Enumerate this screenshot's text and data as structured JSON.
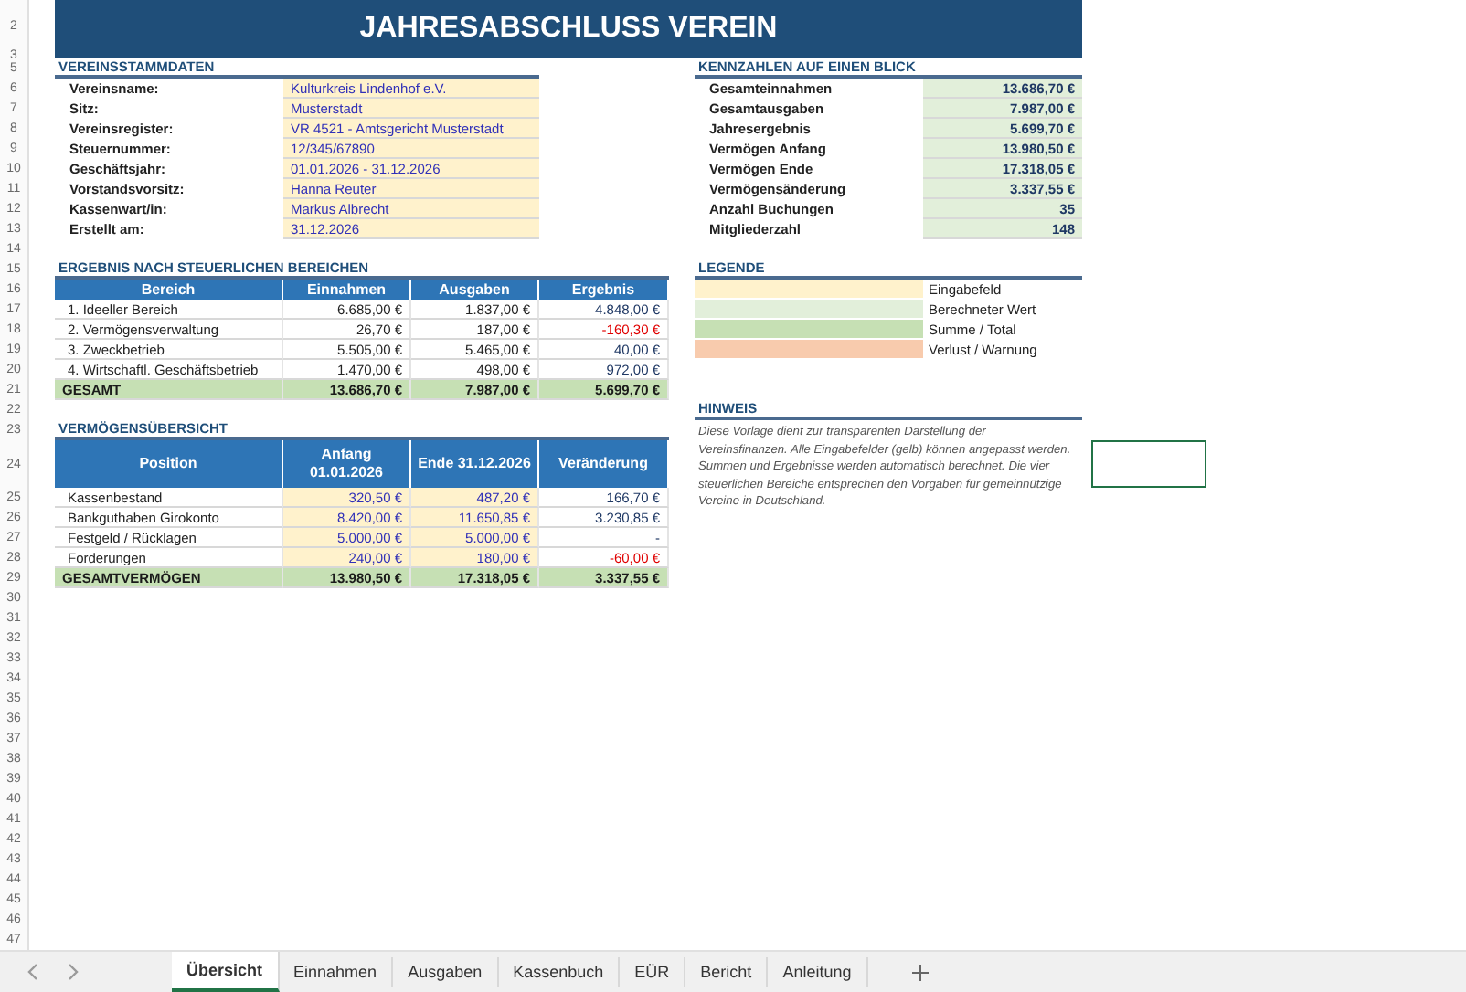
{
  "title": "JAHRESABSCHLUSS VEREIN",
  "row_numbers": [
    "2",
    "3",
    "5",
    "6",
    "7",
    "8",
    "9",
    "10",
    "11",
    "12",
    "13",
    "14",
    "15",
    "16",
    "17",
    "18",
    "19",
    "20",
    "21",
    "22",
    "23",
    "24",
    "25",
    "26",
    "27",
    "28",
    "29",
    "30",
    "31",
    "32",
    "33",
    "34",
    "35",
    "36",
    "37",
    "38",
    "39",
    "40",
    "41",
    "42",
    "43",
    "44",
    "45",
    "46",
    "47"
  ],
  "master_data": {
    "heading": "VEREINSSTAMMDATEN",
    "items": [
      {
        "label": "Vereinsname:",
        "value": "Kulturkreis Lindenhof e.V."
      },
      {
        "label": "Sitz:",
        "value": "Musterstadt"
      },
      {
        "label": "Vereinsregister:",
        "value": "VR 4521 - Amtsgericht Musterstadt"
      },
      {
        "label": "Steuernummer:",
        "value": "12/345/67890"
      },
      {
        "label": "Geschäftsjahr:",
        "value": "01.01.2026 - 31.12.2026"
      },
      {
        "label": "Vorstandsvorsitz:",
        "value": "Hanna Reuter"
      },
      {
        "label": "Kassenwart/in:",
        "value": "Markus Albrecht"
      },
      {
        "label": "Erstellt am:",
        "value": "31.12.2026"
      }
    ]
  },
  "key_figures": {
    "heading": "KENNZAHLEN AUF EINEN BLICK",
    "items": [
      {
        "label": "Gesamteinnahmen",
        "value": "13.686,70 €"
      },
      {
        "label": "Gesamtausgaben",
        "value": "7.987,00 €"
      },
      {
        "label": "Jahresergebnis",
        "value": "5.699,70 €"
      },
      {
        "label": "Vermögen Anfang",
        "value": "13.980,50 €"
      },
      {
        "label": "Vermögen Ende",
        "value": "17.318,05 €"
      },
      {
        "label": "Vermögensänderung",
        "value": "3.337,55 €"
      },
      {
        "label": "Anzahl Buchungen",
        "value": "35"
      },
      {
        "label": "Mitgliederzahl",
        "value": "148"
      }
    ]
  },
  "results": {
    "heading": "ERGEBNIS NACH STEUERLICHEN BEREICHEN",
    "columns": [
      {
        "label": "Bereich",
        "kind": "text"
      },
      {
        "label": "Einnahmen",
        "kind": "calc"
      },
      {
        "label": "Ausgaben",
        "kind": "calc"
      },
      {
        "label": "Ergebnis",
        "kind": "result"
      }
    ],
    "rows": [
      {
        "cells": [
          "1. Ideeller Bereich",
          "6.685,00 €",
          "1.837,00 €",
          "4.848,00 €"
        ],
        "loss": false
      },
      {
        "cells": [
          "2. Vermögensverwaltung",
          "26,70 €",
          "187,00 €",
          "-160,30 €"
        ],
        "loss": true
      },
      {
        "cells": [
          "3. Zweckbetrieb",
          "5.505,00 €",
          "5.465,00 €",
          "40,00 €"
        ],
        "loss": false
      },
      {
        "cells": [
          "4. Wirtschaftl. Geschäftsbetrieb",
          "1.470,00 €",
          "498,00 €",
          "972,00 €"
        ],
        "loss": false
      }
    ],
    "total": [
      "GESAMT",
      "13.686,70 €",
      "7.987,00 €",
      "5.699,70 €"
    ]
  },
  "legend": {
    "heading": "LEGENDE",
    "items": [
      {
        "label": "Eingabefeld",
        "color": "#fff2cc"
      },
      {
        "label": "Berechneter Wert",
        "color": "#e2efda"
      },
      {
        "label": "Summe / Total",
        "color": "#c6e0b4"
      },
      {
        "label": "Verlust / Warnung",
        "color": "#f8cbad"
      }
    ]
  },
  "note": {
    "heading": "HINWEIS",
    "text": "Diese Vorlage dient zur transparenten Darstellung der Vereinsfinanzen. Alle Eingabefelder (gelb) können angepasst werden. Summen und Ergebnisse werden automatisch berechnet. Die vier steuerlichen Bereiche entsprechen den Vorgaben für gemeinnützige Vereine in Deutschland."
  },
  "assets": {
    "heading": "VERMÖGENSÜBERSICHT",
    "columns": [
      {
        "label": "Position",
        "kind": "text"
      },
      {
        "label": "Anfang 01.01.2026",
        "kind": "input"
      },
      {
        "label": "Ende 31.12.2026",
        "kind": "input"
      },
      {
        "label": "Veränderung",
        "kind": "result"
      }
    ],
    "rows": [
      {
        "cells": [
          "Kassenbestand",
          "320,50 €",
          "487,20 €",
          "166,70 €"
        ],
        "loss": false
      },
      {
        "cells": [
          "Bankguthaben Girokonto",
          "8.420,00 €",
          "11.650,85 €",
          "3.230,85 €"
        ],
        "loss": false
      },
      {
        "cells": [
          "Festgeld / Rücklagen",
          "5.000,00 €",
          "5.000,00 €",
          "-"
        ],
        "loss": false
      },
      {
        "cells": [
          "Forderungen",
          "240,00 €",
          "180,00 €",
          "-60,00 €"
        ],
        "loss": true
      }
    ],
    "total": [
      "GESAMTVERMÖGEN",
      "13.980,50 €",
      "17.318,05 €",
      "3.337,55 €"
    ]
  },
  "sheet_tabs": [
    {
      "label": "Übersicht",
      "selected": true
    },
    {
      "label": "Einnahmen",
      "selected": false
    },
    {
      "label": "Ausgaben",
      "selected": false
    },
    {
      "label": "Kassenbuch",
      "selected": false
    },
    {
      "label": "EÜR",
      "selected": false
    },
    {
      "label": "Bericht",
      "selected": false
    },
    {
      "label": "Anleitung",
      "selected": false
    }
  ]
}
